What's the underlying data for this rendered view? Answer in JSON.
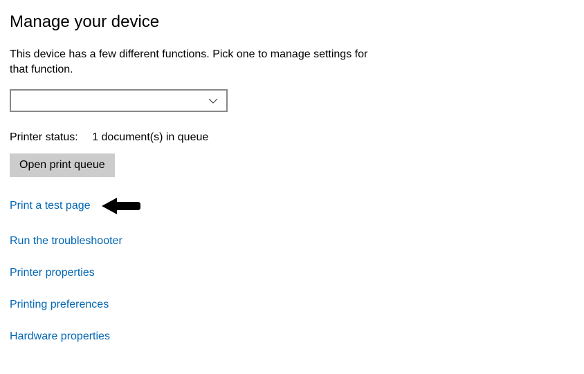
{
  "title": "Manage your device",
  "description": "This device has a few different functions. Pick one to manage settings for that function.",
  "dropdown": {
    "selected": ""
  },
  "status": {
    "label": "Printer status:",
    "value": "1 document(s) in queue"
  },
  "buttons": {
    "open_queue": "Open print queue"
  },
  "links": {
    "print_test": "Print a test page",
    "troubleshooter": "Run the troubleshooter",
    "printer_properties": "Printer properties",
    "printing_preferences": "Printing preferences",
    "hardware_properties": "Hardware properties"
  }
}
